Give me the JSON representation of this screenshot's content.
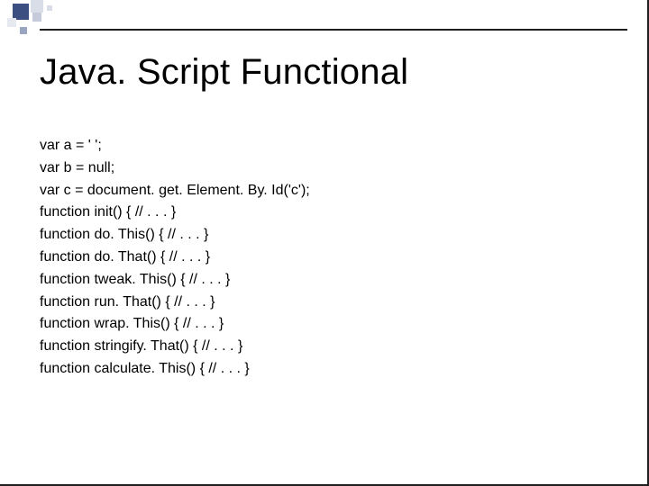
{
  "title": "Java. Script Functional",
  "code_lines": [
    "var a = ' ';",
    "var b = null;",
    "var c = document. get. Element. By. Id('c');",
    "function init() { // . . . }",
    "function do. This() { // . . . }",
    "function do. That() { // . . . }",
    "function tweak. This() { // . . . }",
    "function run. That() { // . . . }",
    "function wrap. This() { // . . . }",
    "function stringify. That() { // . . . }",
    "function calculate. This() { // . . . }"
  ]
}
